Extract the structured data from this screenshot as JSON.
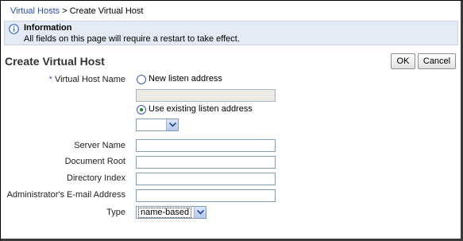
{
  "breadcrumb": {
    "parent_link": "Virtual Hosts",
    "separator": ">",
    "current": "Create Virtual Host"
  },
  "info_box": {
    "icon": "info-icon",
    "title": "Information",
    "message": "All fields on this page will require a restart to take effect."
  },
  "page": {
    "title": "Create Virtual Host"
  },
  "buttons": {
    "ok": "OK",
    "cancel": "Cancel"
  },
  "form": {
    "virtual_host_name": {
      "required_marker": "*",
      "label": "Virtual Host Name",
      "option_new": "New listen address",
      "new_address_value": "",
      "option_existing": "Use existing listen address",
      "existing_selected": true,
      "existing_value": ""
    },
    "server_name": {
      "label": "Server Name",
      "value": ""
    },
    "document_root": {
      "label": "Document Root",
      "value": ""
    },
    "directory_index": {
      "label": "Directory Index",
      "value": ""
    },
    "admin_email": {
      "label": "Administrator's E-mail Address",
      "value": ""
    },
    "type": {
      "label": "Type",
      "value": "name-based"
    }
  },
  "colors": {
    "link": "#2a4ea6",
    "info_background": "#e4ebf4",
    "required_marker": "#3a5fb5"
  }
}
